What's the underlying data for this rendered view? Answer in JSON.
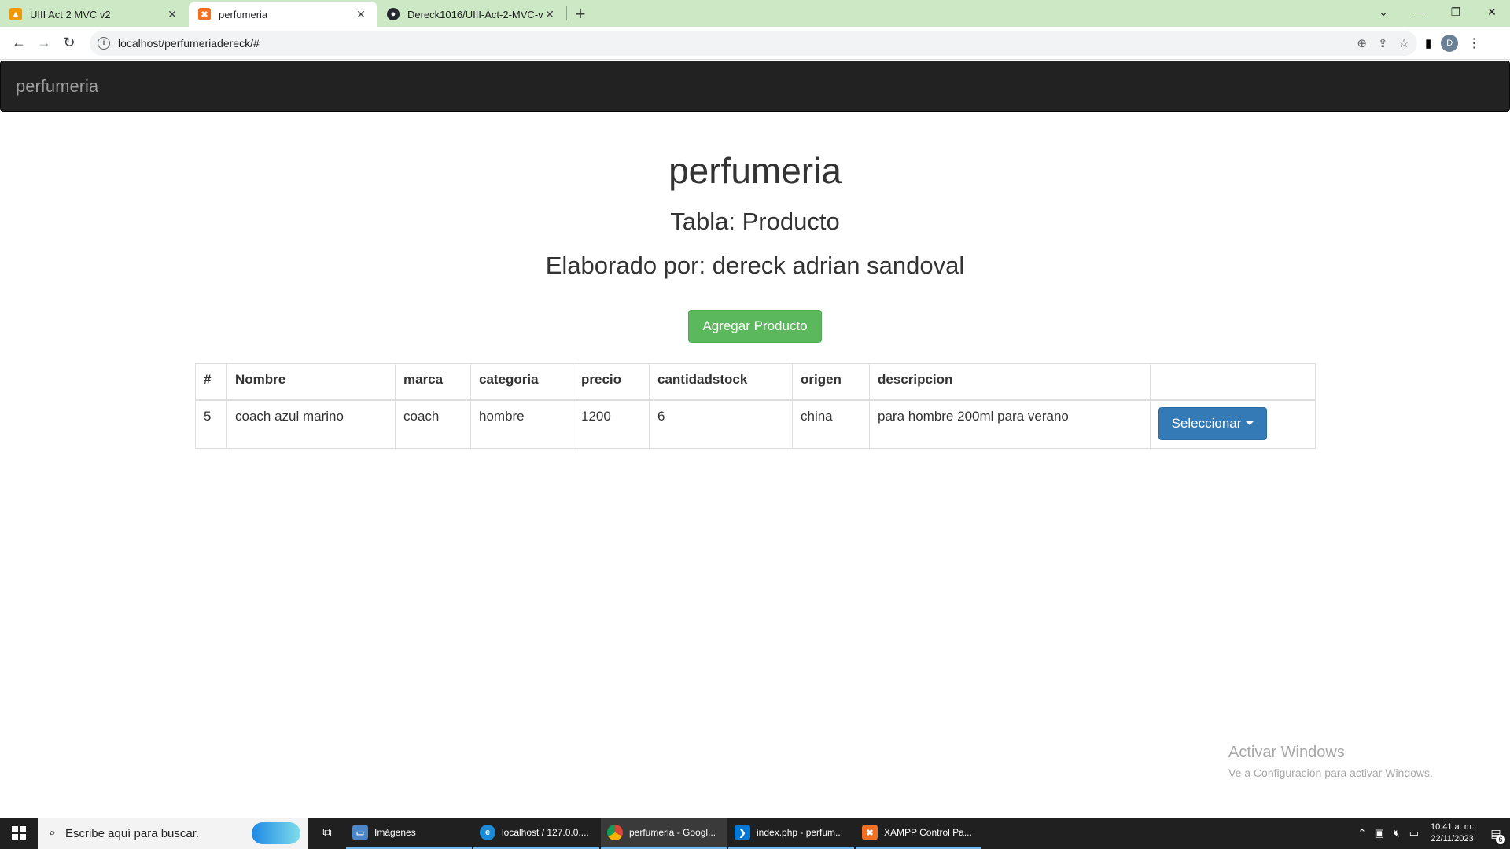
{
  "browser": {
    "tabs": [
      {
        "title": "UIII Act 2 MVC v2",
        "icon": "app-icon",
        "color": "#f29900"
      },
      {
        "title": "perfumeria",
        "icon": "xampp-icon",
        "color": "#f37021"
      },
      {
        "title": "Dereck1016/UIII-Act-2-MVC-v2-",
        "icon": "github-icon",
        "color": "#24292f"
      }
    ],
    "url": "localhost/perfumeriadereck/#",
    "profile_initial": "D"
  },
  "page": {
    "brand": "perfumeria",
    "title": "perfumeria",
    "subtitle": "Tabla: Producto",
    "author": "Elaborado por: dereck adrian sandoval",
    "add_button": "Agregar Producto",
    "table": {
      "headers": [
        "#",
        "Nombre",
        "marca",
        "categoria",
        "precio",
        "cantidadstock",
        "origen",
        "descripcion",
        ""
      ],
      "rows": [
        {
          "id": "5",
          "nombre": "coach azul marino",
          "marca": "coach",
          "categoria": "hombre",
          "precio": "1200",
          "cantidadstock": "6",
          "origen": "china",
          "descripcion": "para hombre 200ml para verano",
          "action": "Seleccionar"
        }
      ]
    },
    "watermark": {
      "line1": "Activar Windows",
      "line2": "Ve a Configuración para activar Windows."
    }
  },
  "colors": {
    "navbar": "#222222",
    "success": "#5cb85c",
    "primary": "#337ab7",
    "tabbar": "#cde8c4"
  },
  "taskbar": {
    "search_placeholder": "Escribe aquí para buscar.",
    "items": [
      {
        "label": "Imágenes",
        "icon": "folder-image-icon"
      },
      {
        "label": "localhost / 127.0.0....",
        "icon": "edge-icon"
      },
      {
        "label": "perfumeria - Googl...",
        "icon": "chrome-icon"
      },
      {
        "label": "index.php - perfum...",
        "icon": "vscode-icon"
      },
      {
        "label": "XAMPP Control Pa...",
        "icon": "xampp-icon"
      }
    ],
    "time": "10:41 a. m.",
    "date": "22/11/2023",
    "notifications": "6"
  }
}
